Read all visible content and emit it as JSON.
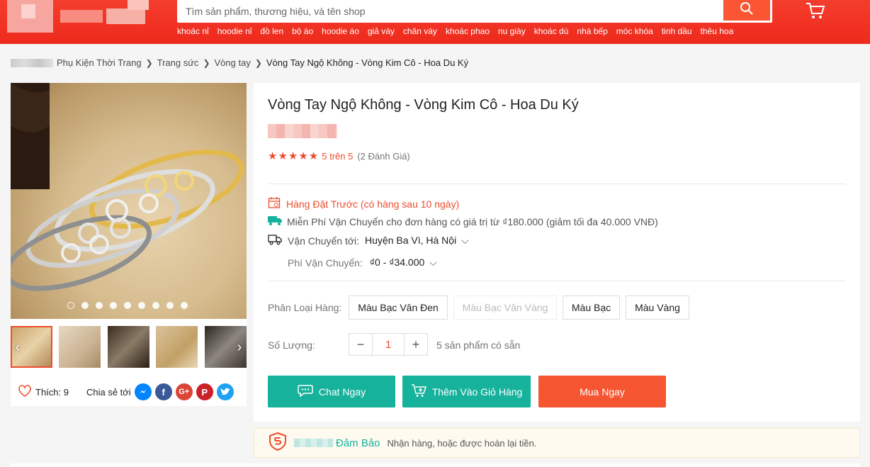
{
  "colors": {
    "brand": "#ee4d2d",
    "header": "#f53d2d",
    "teal": "#16b29c",
    "buy": "#f65532"
  },
  "header": {
    "search_placeholder": "Tìm sản phẩm, thương hiệu, và tên shop",
    "search_icon": "search-icon",
    "cart_icon": "cart-icon",
    "keywords": [
      "khoác nỉ",
      "hoodie nỉ",
      "đồ len",
      "bộ áo",
      "hoodie áo",
      "giả váy",
      "chân váy",
      "khoác phao",
      "nu giày",
      "khoác dù",
      "nhà bếp",
      "móc khóa",
      "tinh dầu",
      "thêu hoa"
    ]
  },
  "breadcrumb": {
    "items": [
      "Phụ Kiện Thời Trang",
      "Trang sức",
      "Vòng tay"
    ],
    "current": "Vòng Tay Ngộ Không - Vòng Kim Cô - Hoa Du Ký"
  },
  "gallery": {
    "dots_count": 9,
    "active_dot": 0,
    "likes_label": "Thích: 9",
    "share_label": "Chia sẻ tới",
    "share_icons": [
      "messenger-icon",
      "facebook-icon",
      "google-plus-icon",
      "pinterest-icon",
      "twitter-icon"
    ]
  },
  "product": {
    "title": "Vòng Tay Ngộ Không - Vòng Kim Cô - Hoa Du Ký",
    "rating_score": "5 trên 5",
    "rating_count": "(2 Đánh Giá)",
    "stars": 5,
    "preorder": "Hàng Đặt Trước (có hàng sau 10 ngày)",
    "free_shipping": "Miễn Phí Vận Chuyển cho đơn hàng có giá trị từ ₫180.000 (giảm tối đa 40.000 VNĐ)",
    "ship_to_label": "Vận Chuyển tới:",
    "ship_to_value": "Huyện Ba Vì, Hà Nội",
    "ship_fee_label": "Phí Vận Chuyển:",
    "ship_fee_value": "₫0 - ₫34.000",
    "variant_label": "Phân Loại Hàng:",
    "variants": [
      {
        "label": "Màu Bạc Vân Đen",
        "disabled": false
      },
      {
        "label": "Màu Bạc Vân Vàng",
        "disabled": true
      },
      {
        "label": "Màu Bạc",
        "disabled": false
      },
      {
        "label": "Màu Vàng",
        "disabled": false
      }
    ],
    "quantity_label": "Số Lượng:",
    "quantity": "1",
    "stock": "5 sản phẩm có sẵn",
    "chat_button": "Chat Ngay",
    "add_cart_button": "Thêm Vào Giỏ Hàng",
    "buy_button": "Mua Ngay"
  },
  "guarantee": {
    "brand": "Đảm Bảo",
    "desc": "Nhận hàng, hoặc được hoàn lại tiền."
  }
}
